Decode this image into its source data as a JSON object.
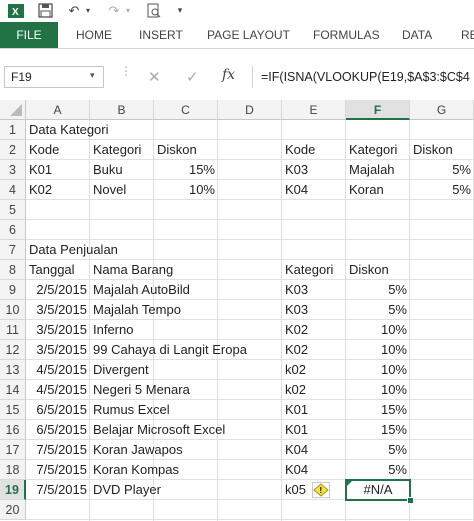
{
  "ribbon_tabs": [
    "FILE",
    "HOME",
    "INSERT",
    "PAGE LAYOUT",
    "FORMULAS",
    "DATA",
    "RE"
  ],
  "namebox": "F19",
  "formula": "=IF(ISNA(VLOOKUP(E19,$A$3:$C$4",
  "fx_label": "fx",
  "columns": [
    "A",
    "B",
    "C",
    "D",
    "E",
    "F",
    "G"
  ],
  "rows": [
    "1",
    "2",
    "3",
    "4",
    "5",
    "6",
    "7",
    "8",
    "9",
    "10",
    "11",
    "12",
    "13",
    "14",
    "15",
    "16",
    "17",
    "18",
    "19",
    "20"
  ],
  "sheet": {
    "title1": "Data Kategori",
    "header_kode": "Kode",
    "header_kategori": "Kategori",
    "header_diskon": "Diskon",
    "k01": "K01",
    "buku": "Buku",
    "d15": "15%",
    "k02": "K02",
    "novel": "Novel",
    "d10": "10%",
    "e_kode": "Kode",
    "f_kategori": "Kategori",
    "g_diskon": "Diskon",
    "k03": "K03",
    "majalah": "Majalah",
    "g5a": "5%",
    "k04": "K04",
    "koran": "Koran",
    "g5b": "5%",
    "title2": "Data Penjualan",
    "h_tanggal": "Tanggal",
    "h_nama": "Nama Barang",
    "h_kategori": "Kategori",
    "h_diskon": "Diskon",
    "sales": [
      [
        "2/5/2015",
        "Majalah AutoBild",
        "K03",
        "5%"
      ],
      [
        "3/5/2015",
        "Majalah Tempo",
        "K03",
        "5%"
      ],
      [
        "3/5/2015",
        "Inferno",
        "K02",
        "10%"
      ],
      [
        "3/5/2015",
        "99 Cahaya di Langit Eropa",
        "K02",
        "10%"
      ],
      [
        "4/5/2015",
        "Divergent",
        "k02",
        "10%"
      ],
      [
        "4/5/2015",
        "Negeri 5 Menara",
        "k02",
        "10%"
      ],
      [
        "6/5/2015",
        "Rumus Excel",
        "K01",
        "15%"
      ],
      [
        "6/5/2015",
        "Belajar Microsoft Excel",
        "K01",
        "15%"
      ],
      [
        "7/5/2015",
        "Koran Jawapos",
        "K04",
        "5%"
      ],
      [
        "7/5/2015",
        "Koran Kompas",
        "K04",
        "5%"
      ],
      [
        "7/5/2015",
        "DVD Player",
        "k05",
        "#N/A"
      ]
    ]
  },
  "colors": {
    "excel_green": "#217346"
  }
}
